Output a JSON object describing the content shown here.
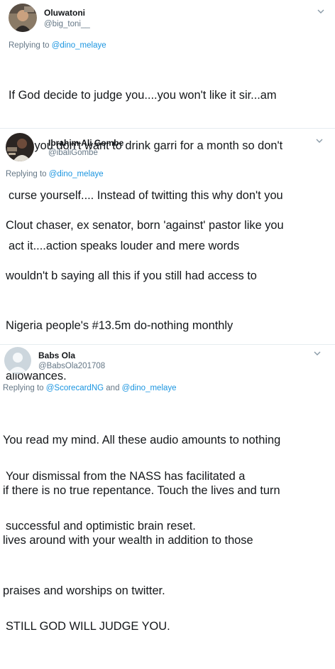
{
  "tweets": [
    {
      "name": "Oluwatoni",
      "handle": "@big_toni__",
      "replying_prefix": "Replying to ",
      "mentions": [
        "@dino_melaye"
      ],
      "joiner": "",
      "lines": [
        "If God decide to judge you....you won't like it sir...am",
        "sure you don't want to drink garri for a month so don't",
        "curse yourself.... Instead of twitting this why don't you",
        "act it....action speaks louder and mere words"
      ]
    },
    {
      "name": "Ibrahim Ali Gombe",
      "handle": "@ibaliGombe",
      "replying_prefix": "Replying to ",
      "mentions": [
        "@dino_melaye"
      ],
      "joiner": "",
      "lines": [
        "Clout chaser, ex senator, born 'against' pastor like you",
        "wouldn't b saying all this if you still had access to",
        "Nigeria people's #13.5m do-nothing monthly",
        "allowances.",
        "",
        "Your dismissal from the NASS has facilitated a",
        "successful and optimistic brain reset.",
        "",
        "STILL GOD WILL JUDGE YOU."
      ]
    },
    {
      "name": "Babs Ola",
      "handle": "@BabsOla201708",
      "replying_prefix": "Replying to ",
      "mentions": [
        "@ScorecardNG",
        "@dino_melaye"
      ],
      "joiner": " and ",
      "lines": [
        "You read my mind. All these audio amounts to nothing",
        "if there is no true repentance. Touch the lives and turn",
        "lives around with your wealth in addition to those",
        "praises and worships on twitter."
      ]
    }
  ],
  "colors": {
    "mention": "#1b95e0",
    "secondary": "#657786",
    "text": "#14171a",
    "divider": "#e6ecf0"
  },
  "icons": {
    "caret": "chevron-down-icon",
    "default_avatar": "default-profile-avatar"
  }
}
